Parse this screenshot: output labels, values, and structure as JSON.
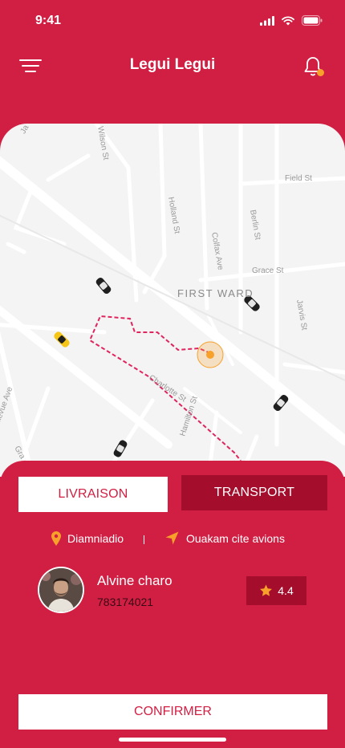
{
  "status_bar": {
    "time": "9:41"
  },
  "header": {
    "title": "Legui Legui"
  },
  "map": {
    "labels": {
      "wilson": "Wilson St",
      "field": "Field St",
      "holland": "Holland St",
      "berlin": "Berlin St",
      "colfax": "Colfax Ave",
      "grace": "Grace St",
      "ward": "FIRST WARD",
      "jarvis": "Jarvis St",
      "charlotte": "Charlotte St",
      "hamilton": "Hamilton St",
      "bellevue": "llevue Ave",
      "corner_top": "Ja",
      "corner_bottom": "Gra"
    },
    "colors": {
      "road": "#ffffff",
      "route": "#e0245e",
      "marker": "#f7a12b",
      "taxi": "#f5c518"
    }
  },
  "tabs": {
    "livraison": "LIVRAISON",
    "transport": "TRANSPORT"
  },
  "route": {
    "from": "Diamniadio",
    "to": "Ouakam cite avions"
  },
  "driver": {
    "name": "Alvine charo",
    "phone": "783174021",
    "rating": "4.4"
  },
  "actions": {
    "confirm": "CONFIRMER"
  },
  "colors": {
    "primary": "#d11f43",
    "primary_dark": "#a40d2c",
    "accent": "#f7a12b"
  }
}
